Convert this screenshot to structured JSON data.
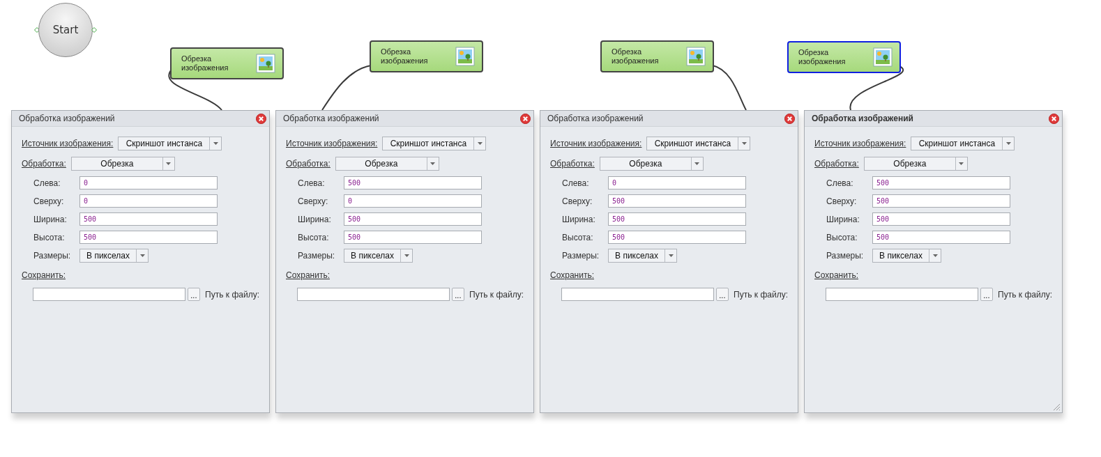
{
  "start_node": {
    "label": "Start"
  },
  "nodes": [
    {
      "label": "Обрезка изображения",
      "selected": false
    },
    {
      "label": "Обрезка изображения",
      "selected": false
    },
    {
      "label": "Обрезка изображения",
      "selected": false
    },
    {
      "label": "Обрезка изображения",
      "selected": true
    }
  ],
  "panels": [
    {
      "title": "Обработка изображений",
      "active": false,
      "source_label": "Источник изображения:",
      "source": "Скриншот инстанса",
      "processing_label": "Обработка:",
      "processing": "Обрезка",
      "fields": [
        {
          "label": "Слева:",
          "value": "0"
        },
        {
          "label": "Сверху:",
          "value": "0"
        },
        {
          "label": "Ширина:",
          "value": "500"
        },
        {
          "label": "Высота:",
          "value": "500"
        }
      ],
      "size_label": "Размеры:",
      "size": "В пикселах",
      "save_label": "Сохранить:",
      "browse": "...",
      "path_label": "Путь к файлу:"
    },
    {
      "title": "Обработка изображений",
      "active": false,
      "source_label": "Источник изображения:",
      "source": "Скриншот инстанса",
      "processing_label": "Обработка:",
      "processing": "Обрезка",
      "fields": [
        {
          "label": "Слева:",
          "value": "500"
        },
        {
          "label": "Сверху:",
          "value": "0"
        },
        {
          "label": "Ширина:",
          "value": "500"
        },
        {
          "label": "Высота:",
          "value": "500"
        }
      ],
      "size_label": "Размеры:",
      "size": "В пикселах",
      "save_label": "Сохранить:",
      "browse": "...",
      "path_label": "Путь к файлу:"
    },
    {
      "title": "Обработка изображений",
      "active": false,
      "source_label": "Источник изображения:",
      "source": "Скриншот инстанса",
      "processing_label": "Обработка:",
      "processing": "Обрезка",
      "fields": [
        {
          "label": "Слева:",
          "value": "0"
        },
        {
          "label": "Сверху:",
          "value": "500"
        },
        {
          "label": "Ширина:",
          "value": "500"
        },
        {
          "label": "Высота:",
          "value": "500"
        }
      ],
      "size_label": "Размеры:",
      "size": "В пикселах",
      "save_label": "Сохранить:",
      "browse": "...",
      "path_label": "Путь к файлу:"
    },
    {
      "title": "Обработка изображений",
      "active": true,
      "source_label": "Источник изображения:",
      "source": "Скриншот инстанса",
      "processing_label": "Обработка:",
      "processing": "Обрезка",
      "fields": [
        {
          "label": "Слева:",
          "value": "500"
        },
        {
          "label": "Сверху:",
          "value": "500"
        },
        {
          "label": "Ширина:",
          "value": "500"
        },
        {
          "label": "Высота:",
          "value": "500"
        }
      ],
      "size_label": "Размеры:",
      "size": "В пикселах",
      "save_label": "Сохранить:",
      "browse": "...",
      "path_label": "Путь к файлу:"
    }
  ]
}
